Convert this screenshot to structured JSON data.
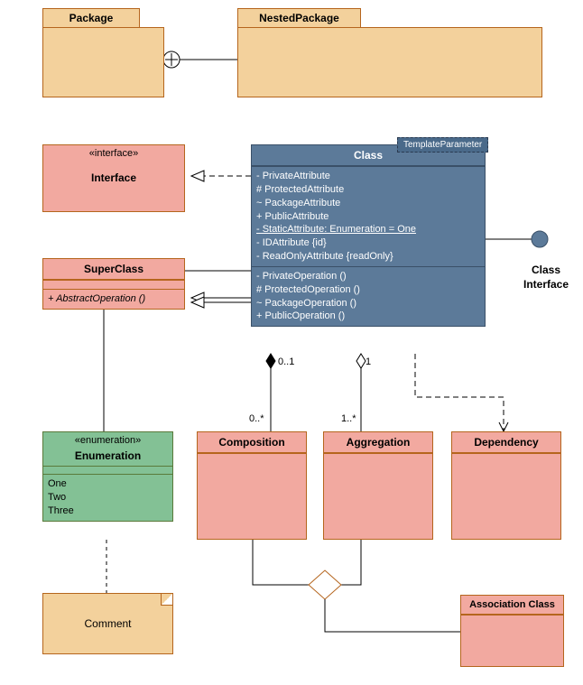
{
  "packages": {
    "package": {
      "label": "Package"
    },
    "nested": {
      "label": "NestedPackage"
    }
  },
  "interface": {
    "stereo": "«interface»",
    "name": "Interface"
  },
  "superclass": {
    "name": "SuperClass",
    "op": "+ AbstractOperation ()"
  },
  "class": {
    "name": "Class",
    "template": "TemplateParameter",
    "attrs": {
      "a1": "- PrivateAttribute",
      "a2": "# ProtectedAttribute",
      "a3": "~ PackageAttribute",
      "a4": "+ PublicAttribute",
      "a5": "- StaticAttribute: Enumeration = One",
      "a6": "- IDAttribute {id}",
      "a7": "- ReadOnlyAttribute {readOnly}"
    },
    "ops": {
      "o1": "- PrivateOperation ()",
      "o2": "# ProtectedOperation ()",
      "o3": "~ PackageOperation ()",
      "o4": "+ PublicOperation ()"
    }
  },
  "lollipop": {
    "line1": "Class",
    "line2": "Interface"
  },
  "enumeration": {
    "stereo": "«enumeration»",
    "name": "Enumeration",
    "vals": {
      "v1": "One",
      "v2": "Two",
      "v3": "Three"
    }
  },
  "composition": {
    "name": "Composition"
  },
  "aggregation": {
    "name": "Aggregation"
  },
  "dependency": {
    "name": "Dependency"
  },
  "assocclass": {
    "name": "Association Class"
  },
  "comment": {
    "text": "Comment"
  },
  "mult": {
    "comp_far": "0..*",
    "comp_near": "0..1",
    "agg_far": "1..*",
    "agg_near": "1"
  },
  "chart_data": {
    "type": "table",
    "title": "UML Class Diagram Elements",
    "nodes": [
      {
        "id": "Package",
        "kind": "package"
      },
      {
        "id": "NestedPackage",
        "kind": "package"
      },
      {
        "id": "Interface",
        "kind": "interface",
        "stereotype": "interface"
      },
      {
        "id": "SuperClass",
        "kind": "class",
        "operations": [
          "+ AbstractOperation ()"
        ],
        "abstractOps": true
      },
      {
        "id": "Class",
        "kind": "class",
        "template": "TemplateParameter",
        "attributes": [
          "- PrivateAttribute",
          "# ProtectedAttribute",
          "~ PackageAttribute",
          "+ PublicAttribute",
          "- StaticAttribute: Enumeration = One",
          "- IDAttribute {id}",
          "- ReadOnlyAttribute {readOnly}"
        ],
        "operations": [
          "- PrivateOperation ()",
          "# ProtectedOperation ()",
          "~ PackageOperation ()",
          "+ PublicOperation ()"
        ]
      },
      {
        "id": "Enumeration",
        "kind": "enumeration",
        "literals": [
          "One",
          "Two",
          "Three"
        ]
      },
      {
        "id": "Composition",
        "kind": "class"
      },
      {
        "id": "Aggregation",
        "kind": "class"
      },
      {
        "id": "Dependency",
        "kind": "class"
      },
      {
        "id": "AssociationClass",
        "kind": "associationClass",
        "label": "Association Class"
      },
      {
        "id": "Comment",
        "kind": "note",
        "text": "Comment"
      },
      {
        "id": "ClassInterface",
        "kind": "providedInterface",
        "label": "Class Interface"
      }
    ],
    "edges": [
      {
        "from": "NestedPackage",
        "to": "Package",
        "type": "containment"
      },
      {
        "from": "Class",
        "to": "Interface",
        "type": "realization"
      },
      {
        "from": "Class",
        "to": "SuperClass",
        "type": "generalization"
      },
      {
        "from": "Class",
        "to": "Enumeration",
        "type": "association"
      },
      {
        "from": "Class",
        "to": "Composition",
        "type": "composition",
        "near": "0..1",
        "far": "0..*"
      },
      {
        "from": "Class",
        "to": "Aggregation",
        "type": "aggregation",
        "near": "1",
        "far": "1..*"
      },
      {
        "from": "Class",
        "to": "Dependency",
        "type": "dependency"
      },
      {
        "from": "Class",
        "to": "ClassInterface",
        "type": "interfaceRealization"
      },
      {
        "from": "Composition",
        "to": "Aggregation",
        "type": "association",
        "via": "AssociationClass"
      },
      {
        "from": "Comment",
        "to": "Enumeration",
        "type": "noteLink"
      }
    ]
  }
}
